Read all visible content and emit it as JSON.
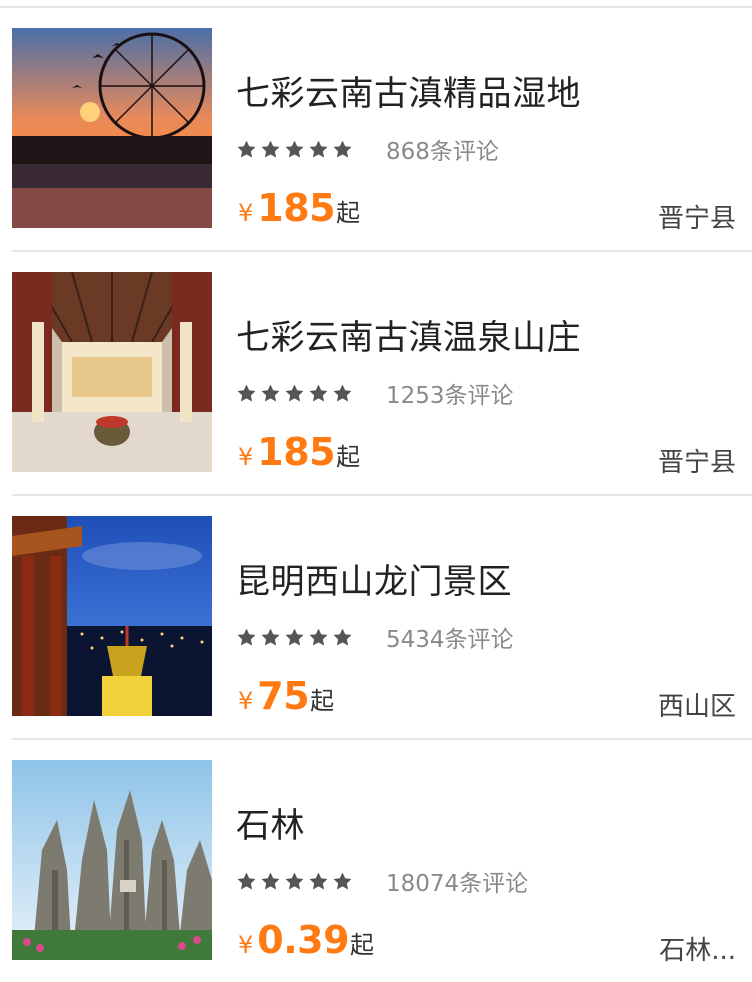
{
  "currency_symbol": "¥",
  "price_suffix": "起",
  "accent_color": "#ff7a12",
  "items": [
    {
      "title": "七彩云南古滇精品湿地",
      "rating_stars": 5,
      "reviews": "868条评论",
      "price": "185",
      "district": "晋宁县",
      "image": "ferris-wheel-sunset"
    },
    {
      "title": "七彩云南古滇温泉山庄",
      "rating_stars": 5,
      "reviews": "1253条评论",
      "price": "185",
      "district": "晋宁县",
      "image": "hotel-lobby"
    },
    {
      "title": "昆明西山龙门景区",
      "rating_stars": 5,
      "reviews": "5434条评论",
      "price": "75",
      "district": "西山区",
      "image": "night-city-pavilion"
    },
    {
      "title": "石林",
      "rating_stars": 5,
      "reviews": "18074条评论",
      "price": "0.39",
      "district": "石林...",
      "image": "stone-forest"
    }
  ]
}
